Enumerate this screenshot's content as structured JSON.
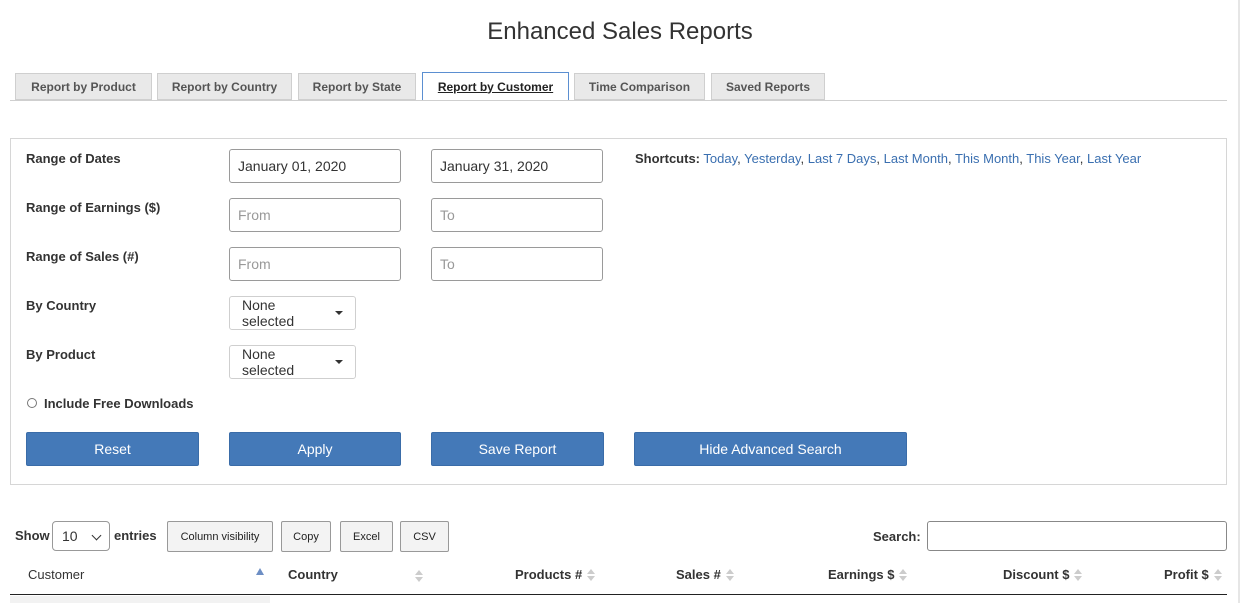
{
  "page": {
    "title": "Enhanced Sales Reports"
  },
  "tabs": [
    {
      "label": "Report by Product"
    },
    {
      "label": "Report by Country"
    },
    {
      "label": "Report by State"
    },
    {
      "label": "Report by Customer",
      "active": true
    },
    {
      "label": "Time Comparison"
    },
    {
      "label": "Saved Reports"
    }
  ],
  "filters": {
    "dates": {
      "label": "Range of Dates",
      "from_value": "January 01, 2020",
      "to_value": "January 31, 2020"
    },
    "earnings": {
      "label": "Range of Earnings ($)",
      "from_placeholder": "From",
      "to_placeholder": "To"
    },
    "sales": {
      "label": "Range of Sales (#)",
      "from_placeholder": "From",
      "to_placeholder": "To"
    },
    "country": {
      "label": "By Country",
      "value": "None selected"
    },
    "product": {
      "label": "By Product",
      "value": "None selected"
    },
    "free_downloads": {
      "label": "Include Free Downloads",
      "checked": false
    },
    "shortcuts": {
      "label": "Shortcuts:",
      "items": [
        "Today",
        "Yesterday",
        "Last 7 Days",
        "Last Month",
        "This Month",
        "This Year",
        "Last Year"
      ]
    }
  },
  "actions": {
    "reset": "Reset",
    "apply": "Apply",
    "save": "Save Report",
    "hide_advanced": "Hide Advanced Search"
  },
  "table": {
    "show_label": "Show",
    "entries_label": "entries",
    "page_length": "10",
    "buttons": {
      "column_visibility": "Column visibility",
      "copy": "Copy",
      "excel": "Excel",
      "csv": "CSV"
    },
    "search_label": "Search:",
    "columns": [
      "Customer",
      "Country",
      "Products #",
      "Sales #",
      "Earnings $",
      "Discount $",
      "Profit $"
    ]
  },
  "colors": {
    "primary_button": "#4479b8",
    "link": "#3a6fb0",
    "active_tab_border": "#5b8fd1"
  }
}
